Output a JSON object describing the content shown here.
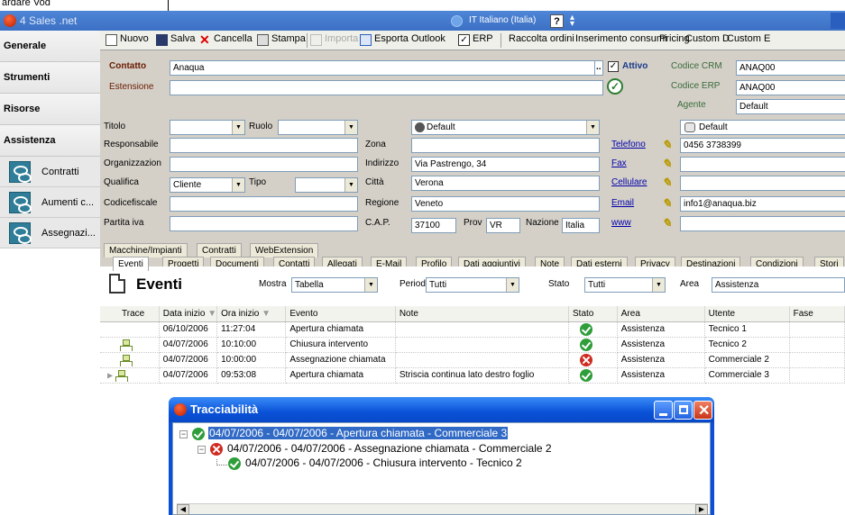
{
  "top_strip": {
    "text": "ardare Vod"
  },
  "app": {
    "title": "4 Sales .net",
    "language": "IT  Italiano (Italia)",
    "help": "?"
  },
  "sidebar": {
    "headers": [
      "Generale",
      "Strumenti",
      "Risorse",
      "Assistenza"
    ],
    "items": [
      {
        "label": "Contratti",
        "icon": "handshake-icon"
      },
      {
        "label": "Aumenti c...",
        "icon": "handshake-icon"
      },
      {
        "label": "Assegnazi...",
        "icon": "handshake-icon"
      }
    ]
  },
  "toolbar": {
    "nuovo": "Nuovo",
    "salva": "Salva",
    "cancella": "Cancella",
    "stampa": "Stampa",
    "importa": "Importa",
    "esporta": "Esporta Outlook",
    "erp": "ERP",
    "raccolta": "Raccolta ordini",
    "inserimento": "Inserimento consumi",
    "pricing": "Pricing",
    "custom_d": "Custom D",
    "custom_e": "Custom E"
  },
  "form": {
    "contatto_label": "Contatto",
    "contatto_value": "Anaqua",
    "estensione_label": "Estensione",
    "attivo_label": "Attivo",
    "codice_crm_label": "Codice CRM",
    "codice_crm_value": "ANAQ00",
    "codice_erp_label": "Codice ERP",
    "codice_erp_value": "ANAQ00",
    "agente_label": "Agente",
    "agente_value": "Default",
    "titolo_label": "Titolo",
    "ruolo_label": "Ruolo",
    "responsabile_label": "Responsabile",
    "organizzazione_label": "Organizzazion",
    "qualifica_label": "Qualifica",
    "qualifica_value": "Cliente",
    "tipo_label": "Tipo",
    "codicefiscale_label": "Codicefiscale",
    "partita_iva_label": "Partita iva",
    "default_select": "Default",
    "default_right": "Default",
    "zona_label": "Zona",
    "indirizzo_label": "Indirizzo",
    "indirizzo_value": "Via Pastrengo, 34",
    "citta_label": "Città",
    "citta_value": "Verona",
    "regione_label": "Regione",
    "regione_value": "Veneto",
    "cap_label": "C.A.P.",
    "cap_value": "37100",
    "prov_label": "Prov",
    "prov_value": "VR",
    "nazione_label": "Nazione",
    "nazione_value": "Italia",
    "telefono_label": "Telefono",
    "telefono_value": "0456 3738399",
    "fax_label": "Fax",
    "cellulare_label": "Cellulare",
    "email_label": "Email",
    "email_value": "info1@anaqua.biz",
    "www_label": "www"
  },
  "tabs_top": [
    "Macchine/Impianti",
    "Contratti",
    "WebExtension"
  ],
  "tabs_sub": [
    "Eventi",
    "Progetti",
    "Documenti",
    "Contatti",
    "Allegati",
    "E-Mail",
    "Profilo",
    "Dati aggiuntivi",
    "Note",
    "Dati esterni",
    "Privacy",
    "Destinazioni",
    "Condizioni",
    "Stori"
  ],
  "events": {
    "heading": "Eventi",
    "mostra_label": "Mostra",
    "mostra_value": "Tabella",
    "periodo_label": "Periodo",
    "periodo_value": "Tutti",
    "stato_label": "Stato",
    "stato_value": "Tutti",
    "area_label": "Area",
    "area_value": "Assistenza"
  },
  "grid": {
    "columns": [
      "Trace",
      "Data inizio",
      "Ora inizio",
      "Evento",
      "Note",
      "Stato",
      "Area",
      "Utente",
      "Fase"
    ],
    "rows": [
      {
        "trace": "",
        "data": "06/10/2006",
        "ora": "11:27:04",
        "evento": "Apertura chiamata",
        "note": "",
        "stato": "ok",
        "area": "Assistenza",
        "utente": "Tecnico 1"
      },
      {
        "trace": "tree",
        "data": "04/07/2006",
        "ora": "10:10:00",
        "evento": "Chiusura intervento",
        "note": "",
        "stato": "ok",
        "area": "Assistenza",
        "utente": "Tecnico 2"
      },
      {
        "trace": "tree",
        "data": "04/07/2006",
        "ora": "10:00:00",
        "evento": "Assegnazione chiamata",
        "note": "",
        "stato": "ko",
        "area": "Assistenza",
        "utente": "Commerciale 2"
      },
      {
        "trace": "tree",
        "data": "04/07/2006",
        "ora": "09:53:08",
        "evento": "Apertura chiamata",
        "note": "Striscia continua lato destro foglio",
        "stato": "ok",
        "area": "Assistenza",
        "utente": "Commerciale 3"
      }
    ]
  },
  "trace_window": {
    "title": "Tracciabilità",
    "nodes": [
      "04/07/2006 - 04/07/2006 - Apertura chiamata - Commerciale 3",
      "04/07/2006 - 04/07/2006 - Assegnazione chiamata - Commerciale 2",
      "04/07/2006 - 04/07/2006 - Chiusura intervento - Tecnico 2"
    ]
  },
  "colors": {
    "titlebar": "#3c70c4",
    "panel": "#d4d0c8",
    "xp_window": "#0b4fd6",
    "selection": "#316ac5"
  }
}
